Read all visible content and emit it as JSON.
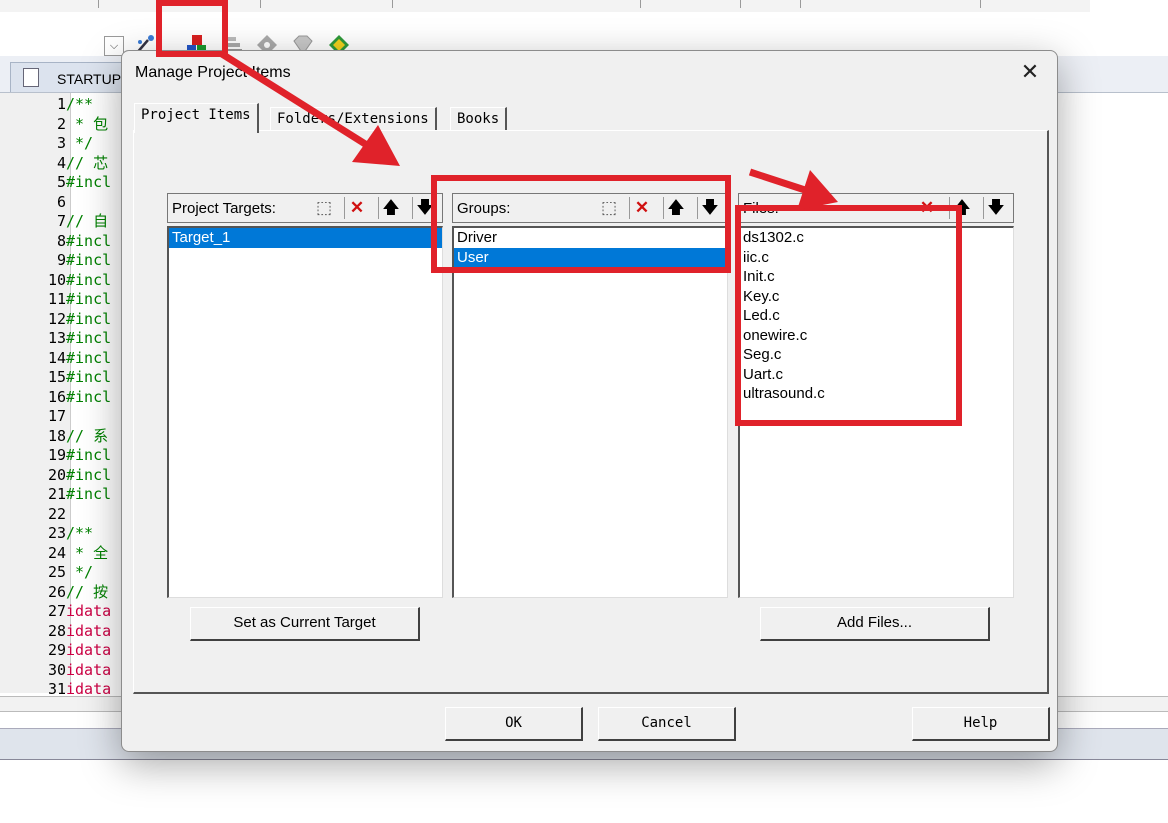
{
  "background_ide": {
    "file_tab_label": "STARTUP",
    "code_lines": [
      {
        "num": "1",
        "text": "/**",
        "cls": "cm"
      },
      {
        "num": "2",
        "text": " * 包",
        "cls": "cm"
      },
      {
        "num": "3",
        "text": " */",
        "cls": "cm"
      },
      {
        "num": "4",
        "text": "// 芯",
        "cls": "cm"
      },
      {
        "num": "5",
        "text": "#incl",
        "cls": "pp"
      },
      {
        "num": "6",
        "text": "",
        "cls": ""
      },
      {
        "num": "7",
        "text": "// 自",
        "cls": "cm"
      },
      {
        "num": "8",
        "text": "#incl",
        "cls": "pp"
      },
      {
        "num": "9",
        "text": "#incl",
        "cls": "pp"
      },
      {
        "num": "10",
        "text": "#incl",
        "cls": "pp"
      },
      {
        "num": "11",
        "text": "#incl",
        "cls": "pp"
      },
      {
        "num": "12",
        "text": "#incl",
        "cls": "pp"
      },
      {
        "num": "13",
        "text": "#incl",
        "cls": "pp"
      },
      {
        "num": "14",
        "text": "#incl",
        "cls": "pp"
      },
      {
        "num": "15",
        "text": "#incl",
        "cls": "pp"
      },
      {
        "num": "16",
        "text": "#incl",
        "cls": "pp"
      },
      {
        "num": "17",
        "text": "",
        "cls": ""
      },
      {
        "num": "18",
        "text": "// 系",
        "cls": "cm"
      },
      {
        "num": "19",
        "text": "#incl",
        "cls": "pp"
      },
      {
        "num": "20",
        "text": "#incl",
        "cls": "pp"
      },
      {
        "num": "21",
        "text": "#incl",
        "cls": "pp"
      },
      {
        "num": "22",
        "text": "",
        "cls": ""
      },
      {
        "num": "23",
        "text": "/**",
        "cls": "cm"
      },
      {
        "num": "24",
        "text": " * 全",
        "cls": "cm"
      },
      {
        "num": "25",
        "text": " */",
        "cls": "cm"
      },
      {
        "num": "26",
        "text": "// 按",
        "cls": "cm"
      },
      {
        "num": "27",
        "text": "idata",
        "cls": "kw"
      },
      {
        "num": "28",
        "text": "idata",
        "cls": "kw"
      },
      {
        "num": "29",
        "text": "idata",
        "cls": "kw"
      },
      {
        "num": "30",
        "text": "idata",
        "cls": "kw"
      },
      {
        "num": "31",
        "text": "idata",
        "cls": "kw"
      }
    ]
  },
  "dialog": {
    "title": "Manage Project Items",
    "close": "✕",
    "tabs": [
      "Project Items",
      "Folders/Extensions",
      "Books"
    ],
    "targets_label": "Project Targets:",
    "targets": [
      "Target_1"
    ],
    "targets_selected": 0,
    "groups_label": "Groups:",
    "groups": [
      "Driver",
      "User"
    ],
    "groups_selected": 1,
    "files_label": "Files:",
    "files": [
      "ds1302.c",
      "iic.c",
      "Init.c",
      "Key.c",
      "Led.c",
      "onewire.c",
      "Seg.c",
      "Uart.c",
      "ultrasound.c"
    ],
    "set_current_target": "Set as Current Target",
    "add_files": "Add Files...",
    "ok": "OK",
    "cancel": "Cancel",
    "help": "Help",
    "glyphs": {
      "new": "⬚",
      "delete": "✕",
      "up": "🡅",
      "down": "🡇"
    }
  },
  "colors": {
    "annotation_red": "#e0222a",
    "selection_blue": "#0078d7"
  }
}
